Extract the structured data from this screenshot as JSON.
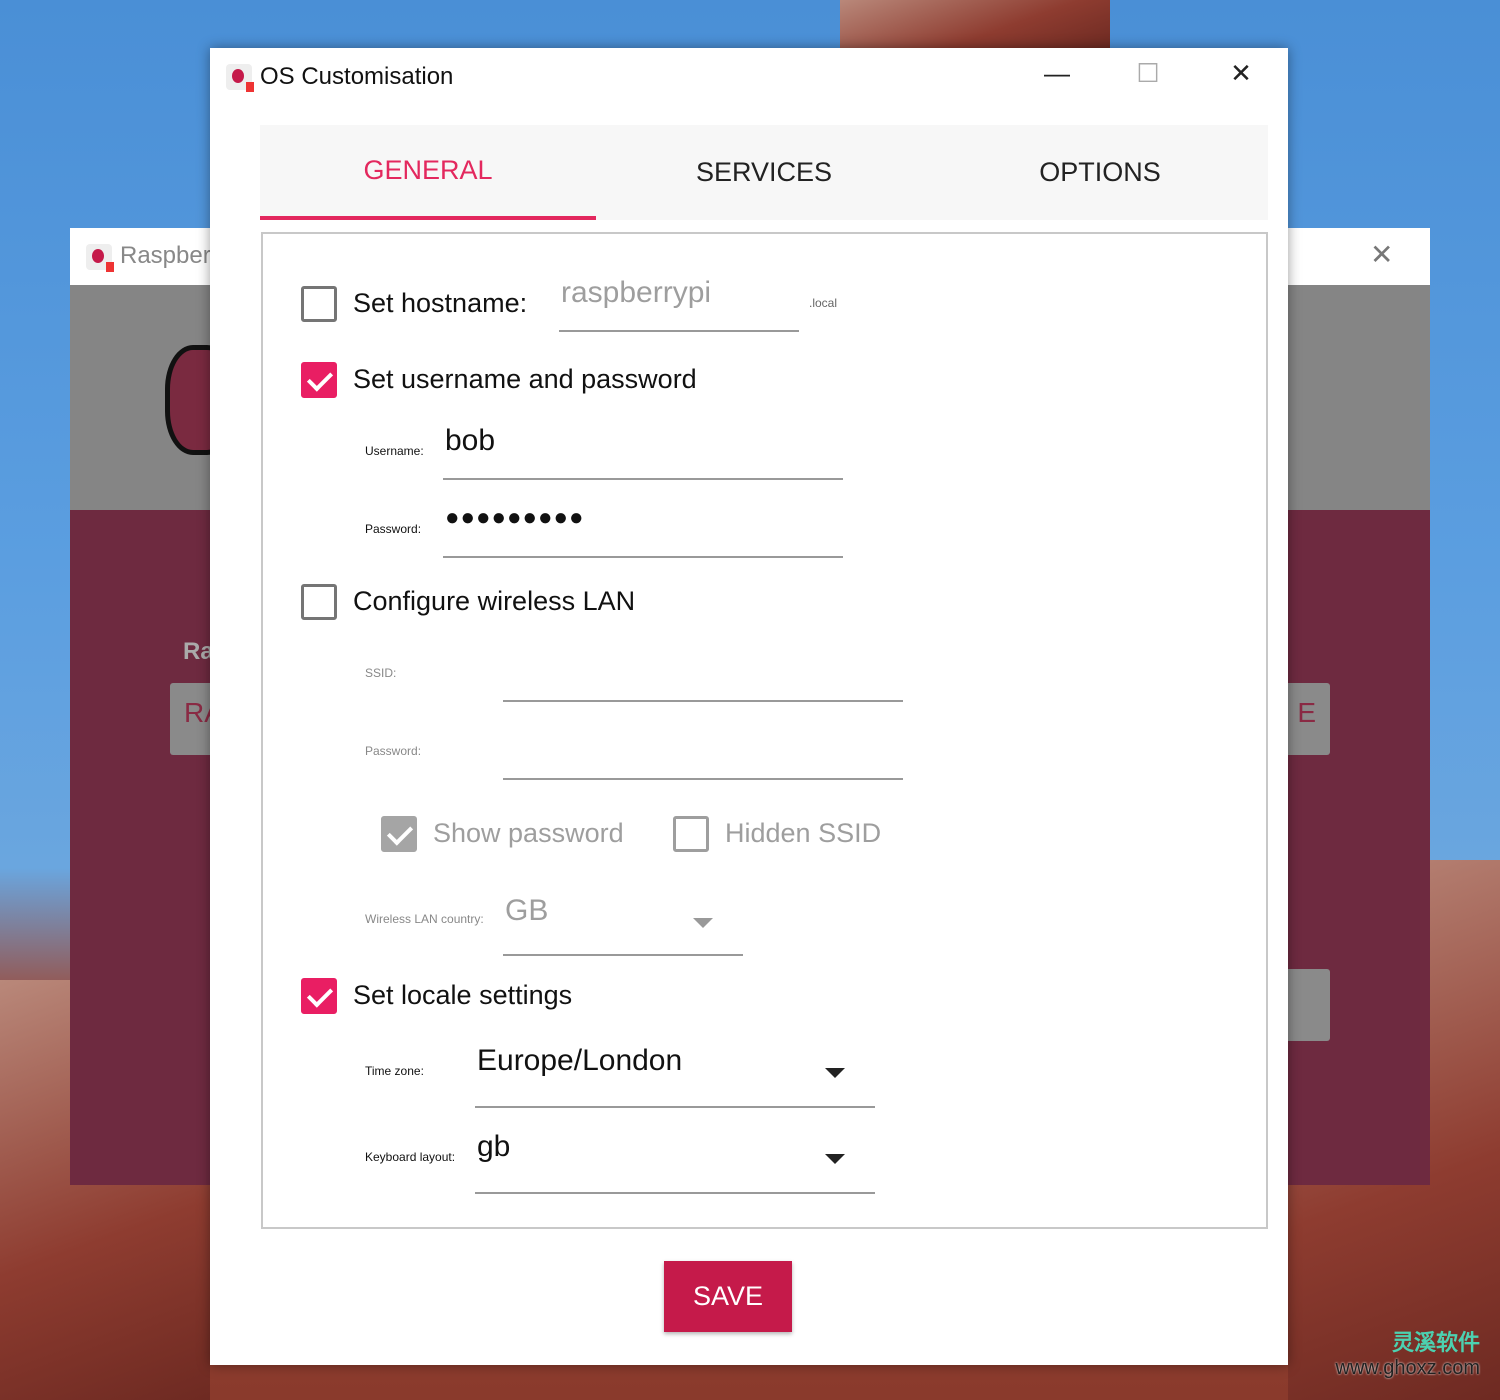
{
  "background_window": {
    "title": "Raspberr",
    "label_fragment": "Ra",
    "button_left": "RA",
    "button_right": "E"
  },
  "dialog": {
    "title": "OS Customisation",
    "controls": {
      "minimize": "—",
      "maximize": "☐",
      "close": "✕"
    }
  },
  "tabs": [
    {
      "label": "GENERAL",
      "active": true
    },
    {
      "label": "SERVICES"
    },
    {
      "label": "OPTIONS"
    }
  ],
  "general": {
    "hostname": {
      "label": "Set hostname:",
      "checked": false,
      "value": "raspberrypi",
      "suffix": ".local"
    },
    "user": {
      "label": "Set username and password",
      "checked": true,
      "username_label": "Username:",
      "username": "bob",
      "password_label": "Password:",
      "password": "●●●●●●●●●"
    },
    "wlan": {
      "label": "Configure wireless LAN",
      "checked": false,
      "ssid_label": "SSID:",
      "ssid": "",
      "password_label": "Password:",
      "password": "",
      "show_password": {
        "label": "Show password",
        "checked": true
      },
      "hidden_ssid": {
        "label": "Hidden SSID",
        "checked": false
      },
      "country_label": "Wireless LAN country:",
      "country": "GB"
    },
    "locale": {
      "label": "Set locale settings",
      "checked": true,
      "timezone_label": "Time zone:",
      "timezone": "Europe/London",
      "keyboard_label": "Keyboard layout:",
      "keyboard": "gb"
    }
  },
  "save_label": "SAVE",
  "colors": {
    "accent": "#e3285e",
    "save": "#c51a4a",
    "checkbox": "#e91e63"
  },
  "watermark": {
    "brand": "灵溪软件",
    "url": "www.ghoxz.com"
  }
}
